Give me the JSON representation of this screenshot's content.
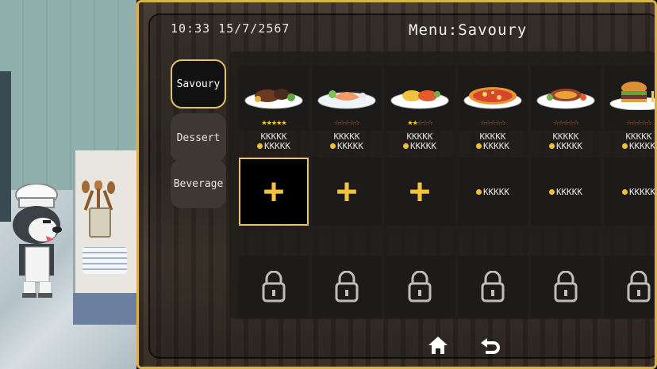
{
  "header": {
    "clock": "10:33  15/7/2567",
    "title": "Menu:Savoury"
  },
  "tabs": [
    {
      "label": "Savoury",
      "active": true
    },
    {
      "label": "Dessert",
      "active": false
    },
    {
      "label": "Beverage",
      "active": false
    }
  ],
  "dishes": [
    {
      "icon": "steak-plate-icon",
      "name": "KKKKK",
      "price": "KKKKK",
      "rating": 5
    },
    {
      "icon": "salmon-plate-icon",
      "name": "KKKKK",
      "price": "KKKKK",
      "rating": 0
    },
    {
      "icon": "omelette-plate-icon",
      "name": "KKKKK",
      "price": "KKKKK",
      "rating": 2
    },
    {
      "icon": "pizza-plate-icon",
      "name": "KKKKK",
      "price": "KKKKK",
      "rating": 0
    },
    {
      "icon": "sausage-plate-icon",
      "name": "KKKKK",
      "price": "KKKKK",
      "rating": 0
    },
    {
      "icon": "burger-plate-icon",
      "name": "KKKKK",
      "price": "KKKKK",
      "rating": 0
    }
  ],
  "slots": [
    {
      "type": "add",
      "selected": true
    },
    {
      "type": "add",
      "selected": false
    },
    {
      "type": "add",
      "selected": false
    },
    {
      "type": "price",
      "price": "KKKKK"
    },
    {
      "type": "price",
      "price": "KKKKK"
    },
    {
      "type": "price",
      "price": "KKKKK"
    }
  ],
  "colors": {
    "gold": "#e3c263",
    "star_on": "#f5c41b",
    "star_off": "#c66a2a",
    "coin": "#f2c230"
  }
}
